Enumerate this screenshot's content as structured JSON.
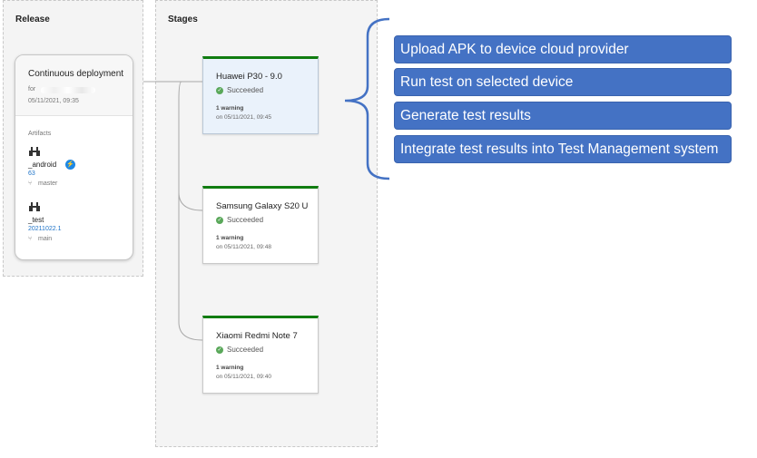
{
  "release": {
    "panel_title": "Release",
    "card": {
      "title": "Continuous deployment",
      "for_label": "for",
      "date": "05/11/2021, 09:35"
    },
    "artifacts_label": "Artifacts",
    "artifacts": [
      {
        "name": "_android",
        "version": "63",
        "branch": "master",
        "icon": "build-artifact-icon",
        "badge_icon": "continuous-deployment-icon"
      },
      {
        "name": "_test",
        "version": "20211022.1",
        "branch": "main",
        "icon": "build-artifact-icon"
      }
    ]
  },
  "stages": {
    "panel_title": "Stages",
    "items": [
      {
        "name": "Huawei P30 - 9.0",
        "status": "Succeeded",
        "warnings": "1 warning",
        "date": "on 05/11/2021, 09:45",
        "selected": true
      },
      {
        "name": "Samsung Galaxy S20 U",
        "status": "Succeeded",
        "warnings": "1 warning",
        "date": "on 05/11/2021, 09:48",
        "selected": false
      },
      {
        "name": "Xiaomi Redmi Note 7",
        "status": "Succeeded",
        "warnings": "1 warning",
        "date": "on 05/11/2021, 09:40",
        "selected": false
      }
    ]
  },
  "tasks": [
    "Upload APK to device cloud provider",
    "Run test on selected device",
    "Generate test results",
    "Integrate test results into Test Management system"
  ],
  "colors": {
    "stage_success": "#107c10",
    "task_fill": "#4472c4",
    "brace": "#4472c4"
  }
}
